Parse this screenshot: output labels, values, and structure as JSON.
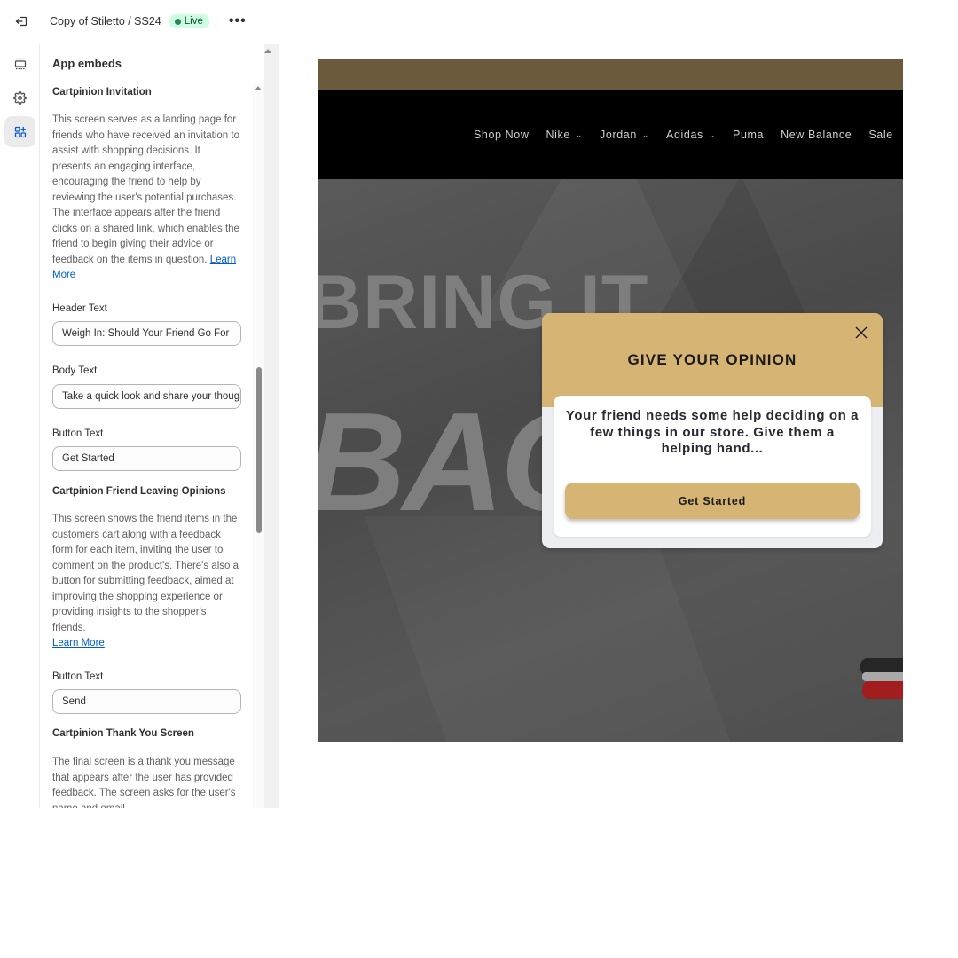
{
  "topbar": {
    "exit_icon": "exit-icon",
    "title": "Copy of Stiletto / SS24",
    "status_badge": "Live",
    "more_icon": "more-horizontal-icon",
    "more_label": "•••"
  },
  "rail": {
    "items": [
      {
        "name": "sections",
        "icon": "sections-icon",
        "active": false
      },
      {
        "name": "settings",
        "icon": "gear-icon",
        "active": false
      },
      {
        "name": "app-embeds",
        "icon": "apps-add-icon",
        "active": true
      }
    ]
  },
  "panel": {
    "title": "App embeds",
    "sections": [
      {
        "title": "Cartpinion Invitation",
        "description": "This screen serves as a landing page for friends who have received an invitation to assist with shopping decisions. It presents an engaging interface, encouraging the friend to help by reviewing the user's potential purchases. The interface appears after the friend clicks on a shared link, which enables the friend to begin giving their advice or feedback on the items in question.",
        "link": "Learn More",
        "fields": [
          {
            "label": "Header Text",
            "value": "Weigh In: Should Your Friend Go For"
          },
          {
            "label": "Body Text",
            "value": "Take a quick look and share your thoughts"
          },
          {
            "label": "Button Text",
            "value": "Get Started"
          }
        ]
      },
      {
        "title": "Cartpinion Friend Leaving Opinions",
        "description": "This screen shows the friend items in the customers cart along with a feedback form for each item, inviting the user to comment on the product's. There's also a button for submitting feedback, aimed at improving the shopping experience or providing insights to the shopper's friends.",
        "link": "Learn More",
        "fields": [
          {
            "label": "Button Text",
            "value": "Send"
          }
        ]
      },
      {
        "title": "Cartpinion Thank You Screen",
        "description": "The final screen is a thank you message that appears after the user has provided feedback. The screen asks for the user's name and email"
      }
    ]
  },
  "preview": {
    "nav": [
      {
        "label": "Shop Now",
        "dropdown": false
      },
      {
        "label": "Nike",
        "dropdown": true
      },
      {
        "label": "Jordan",
        "dropdown": true
      },
      {
        "label": "Adidas",
        "dropdown": true
      },
      {
        "label": "Puma",
        "dropdown": false
      },
      {
        "label": "New Balance",
        "dropdown": false
      },
      {
        "label": "Sale",
        "dropdown": false
      }
    ],
    "chevron_glyph": "⌄",
    "hero": {
      "line1": "BRING IT",
      "line2": "BACK"
    },
    "modal": {
      "title": "GIVE YOUR OPINION",
      "body": "Your friend needs some help deciding on a few things in our store. Give them a helping hand...",
      "button": "Get Started",
      "close_icon": "close-icon"
    },
    "colors": {
      "announcement_bar": "#6b5a3c",
      "accent_gold": "#d6b574",
      "nav_bg": "#000000"
    }
  }
}
